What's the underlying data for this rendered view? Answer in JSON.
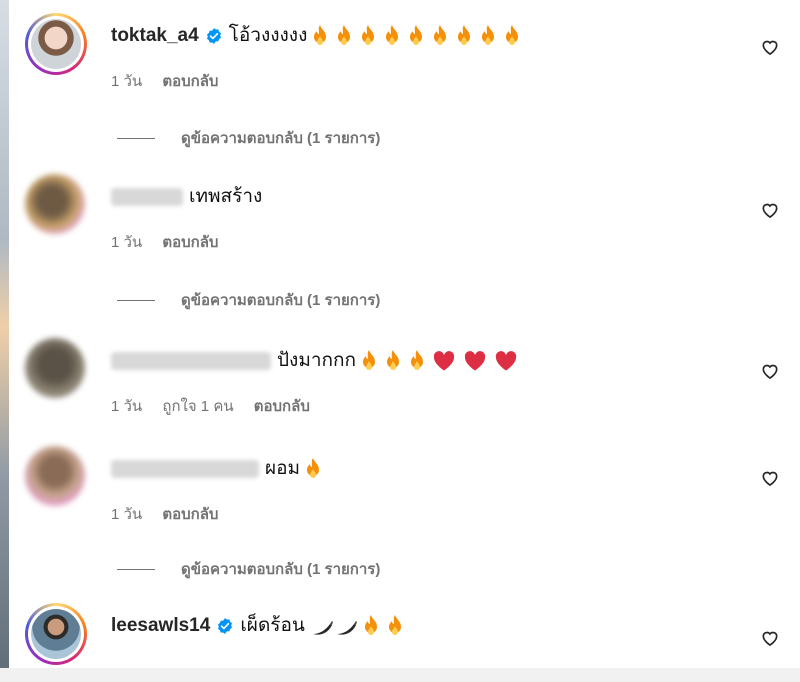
{
  "comments": [
    {
      "username": "toktak_a4",
      "verified": true,
      "text": "โอ้วงงงงง",
      "emoji_names": [
        "fire",
        "fire",
        "fire",
        "fire",
        "fire",
        "fire",
        "fire",
        "fire",
        "fire"
      ],
      "time": "1 วัน",
      "likes": "",
      "reply_label": "ตอบกลับ",
      "view_replies": "ดูข้อความตอบกลับ (1 รายการ)"
    },
    {
      "username": "",
      "verified": false,
      "text": "เทพสร้าง",
      "emoji_names": [],
      "time": "1 วัน",
      "likes": "",
      "reply_label": "ตอบกลับ",
      "view_replies": "ดูข้อความตอบกลับ (1 รายการ)"
    },
    {
      "username": "",
      "verified": false,
      "text": "ปังมากกก",
      "emoji_names": [
        "fire",
        "fire",
        "fire",
        "red-heart",
        "red-heart",
        "red-heart"
      ],
      "time": "1 วัน",
      "likes": "ถูกใจ 1 คน",
      "reply_label": "ตอบกลับ",
      "view_replies": ""
    },
    {
      "username": "",
      "verified": false,
      "text": "ผอม",
      "emoji_names": [
        "fire"
      ],
      "time": "1 วัน",
      "likes": "",
      "reply_label": "ตอบกลับ",
      "view_replies": "ดูข้อความตอบกลับ (1 รายการ)"
    },
    {
      "username": "leesawls14",
      "verified": true,
      "text": "เผ็ดร้อน",
      "emoji_names": [
        "chili",
        "chili",
        "fire",
        "fire"
      ],
      "time": "",
      "likes": "",
      "reply_label": "",
      "view_replies": ""
    }
  ],
  "icons": {
    "like": "heart-outline-icon",
    "verified": "verified-badge-icon"
  },
  "colors": {
    "verified_blue": "#0095f6",
    "meta_gray": "#737373",
    "fire_orange": "#f4900c",
    "heart_red": "#dd2e44"
  }
}
